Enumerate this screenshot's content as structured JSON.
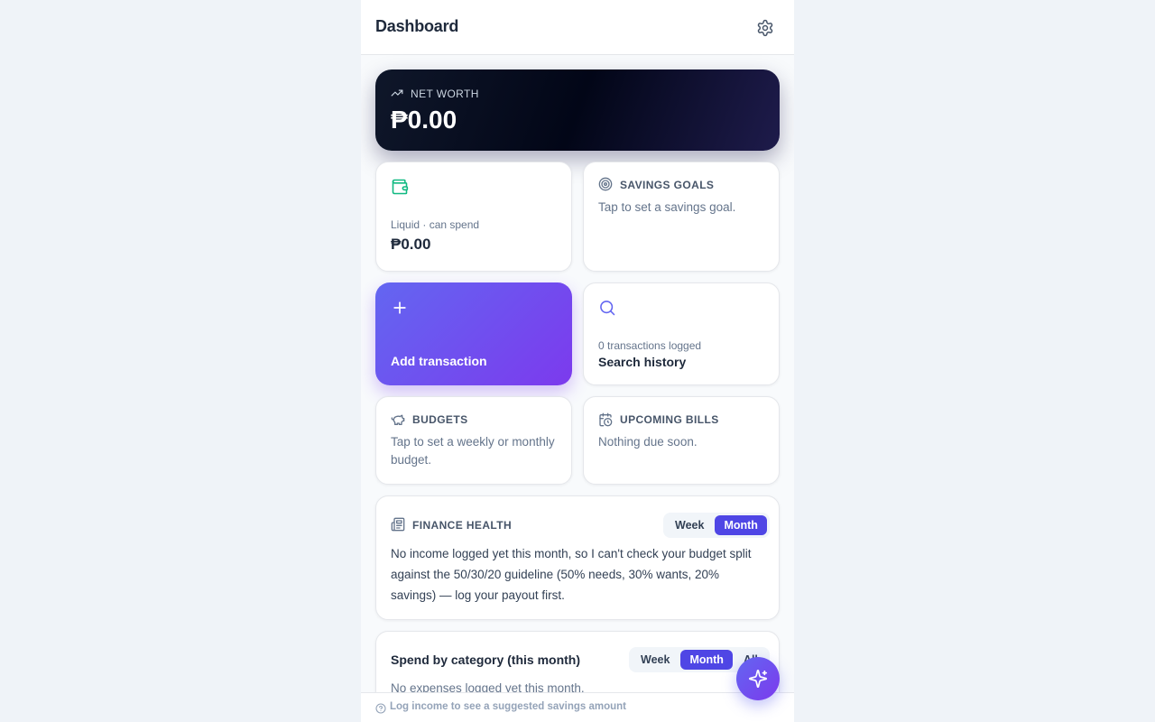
{
  "header": {
    "title": "Dashboard",
    "settings_icon": "gear-icon"
  },
  "net_worth": {
    "label": "NET WORTH",
    "value": "₱0.00",
    "icon": "trending-up-icon"
  },
  "liquid": {
    "label": "Liquid · can spend",
    "value": "₱0.00",
    "icon": "wallet-icon"
  },
  "savings_goals": {
    "label": "SAVINGS GOALS",
    "hint": "Tap to set a savings goal.",
    "icon": "target-icon"
  },
  "add_transaction": {
    "label": "Add transaction",
    "icon": "plus-icon"
  },
  "search_history": {
    "count": "0 transactions logged",
    "label": "Search history",
    "icon": "search-icon"
  },
  "budgets": {
    "label": "BUDGETS",
    "hint": "Tap to set a weekly or monthly budget.",
    "icon": "piggy-bank-icon"
  },
  "upcoming_bills": {
    "label": "UPCOMING BILLS",
    "hint": "Nothing due soon.",
    "icon": "calendar-clock-icon"
  },
  "finance_health": {
    "label": "FINANCE HEALTH",
    "icon": "newspaper-icon",
    "toggle": {
      "week": "Week",
      "month": "Month",
      "active": "Month"
    },
    "message": "No income logged yet this month, so I can't check your budget split against the 50/30/20 guideline (50% needs, 30% wants, 20% savings) — log your payout first."
  },
  "spend_by_category": {
    "title": "Spend by category (this month)",
    "toggle": {
      "week": "Week",
      "month": "Month",
      "all": "All",
      "active": "Month"
    },
    "empty": "No expenses logged yet this month."
  },
  "footer": {
    "hint": "Log income to see a suggested savings amount",
    "icon": "help-circle-icon"
  },
  "fab": {
    "icon": "sparkles-icon"
  },
  "colors": {
    "accent": "#4f46e5",
    "accent_2": "#7c3aed",
    "wallet_green": "#10b981"
  }
}
